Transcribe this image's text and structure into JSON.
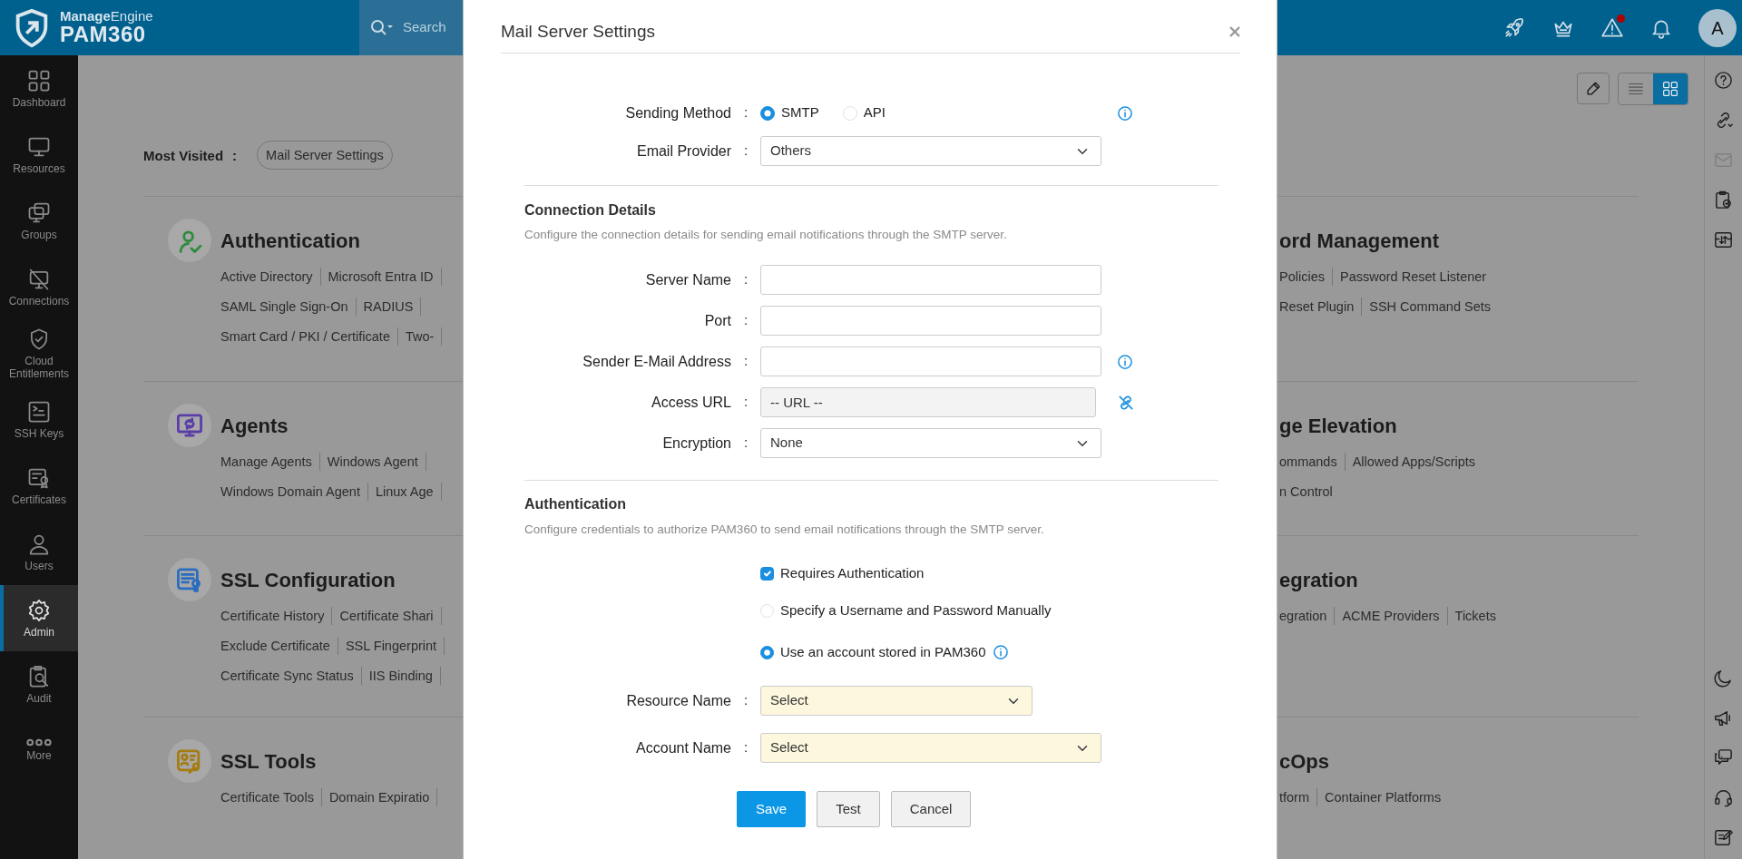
{
  "brand": {
    "company": "**Manage**Engine",
    "product": "PAM360"
  },
  "search": {
    "placeholder": "Search"
  },
  "topbar": {
    "alert_dot": true,
    "avatar": "A"
  },
  "sidebar": {
    "items": [
      {
        "label": "Dashboard",
        "selected": false
      },
      {
        "label": "Resources",
        "selected": false
      },
      {
        "label": "Groups",
        "selected": false
      },
      {
        "label": "Connections",
        "selected": false
      },
      {
        "label": "Cloud Entitlements",
        "selected": false
      },
      {
        "label": "SSH Keys",
        "selected": false
      },
      {
        "label": "Certificates",
        "selected": false
      },
      {
        "label": "Users",
        "selected": false
      },
      {
        "label": "Admin",
        "selected": true
      },
      {
        "label": "Audit",
        "selected": false
      },
      {
        "label": "More",
        "selected": false
      }
    ]
  },
  "toolbar": {
    "views": [
      {
        "kind": "list",
        "selected": false
      },
      {
        "kind": "grid",
        "selected": true
      }
    ]
  },
  "most_visited": {
    "label": "Most Visited",
    "colon": ":",
    "chips": [
      "Mail Server Settings"
    ]
  },
  "sections_left": [
    {
      "title": "Authentication",
      "color": "#2e8b3e",
      "rows": [
        [
          "Active Directory",
          "Microsoft Entra ID"
        ],
        [
          "SAML Single Sign-On",
          "RADIUS"
        ],
        [
          "Smart Card / PKI / Certificate",
          "Two-"
        ]
      ]
    },
    {
      "title": "Agents",
      "color": "#5a3da8",
      "rows": [
        [
          "Manage Agents",
          "Windows Agent"
        ],
        [
          "Windows Domain Agent",
          "Linux Age"
        ]
      ]
    },
    {
      "title": "SSL Configuration",
      "color": "#2a6cc0",
      "rows": [
        [
          "Certificate History",
          "Certificate Shari"
        ],
        [
          "Exclude Certificate",
          "SSL Fingerprint"
        ],
        [
          "Certificate Sync Status",
          "IIS Binding"
        ]
      ]
    },
    {
      "title": "SSL Tools",
      "color": "#a57c12",
      "rows": [
        [
          "Certificate Tools",
          "Domain Expiratio"
        ]
      ]
    }
  ],
  "sections_right": [
    {
      "title": "ord Management",
      "rows": [
        [
          "Policies",
          "Password Reset Listener"
        ],
        [
          "Reset Plugin",
          "SSH Command Sets"
        ]
      ]
    },
    {
      "title": "ge Elevation",
      "rows": [
        [
          "ommands",
          "Allowed Apps/Scripts"
        ],
        [
          "n Control"
        ]
      ]
    },
    {
      "title": "egration",
      "rows": [
        [
          "egration",
          "ACME Providers",
          "Tickets"
        ]
      ]
    },
    {
      "title": "cOps",
      "rows": [
        [
          "tform",
          "Container Platforms"
        ]
      ]
    }
  ],
  "rail": {
    "top": [
      {
        "kind": "help",
        "disabled": false
      },
      {
        "kind": "link",
        "disabled": false
      },
      {
        "kind": "mail",
        "disabled": true
      },
      {
        "kind": "clipboard",
        "disabled": false
      },
      {
        "kind": "transfer",
        "disabled": false
      }
    ],
    "bottom": [
      {
        "kind": "moon",
        "disabled": false
      },
      {
        "kind": "megaphone",
        "disabled": false
      },
      {
        "kind": "chat",
        "disabled": false
      },
      {
        "kind": "headset",
        "disabled": false
      },
      {
        "kind": "note",
        "disabled": false
      }
    ]
  },
  "modal": {
    "title": "Mail Server Settings",
    "sending_method": {
      "label": "Sending Method",
      "colon": ":",
      "options": [
        {
          "label": "SMTP",
          "selected": true
        },
        {
          "label": "API",
          "selected": false
        }
      ]
    },
    "email_provider": {
      "label": "Email Provider",
      "colon": ":",
      "value": "Others"
    },
    "connection": {
      "title": "Connection Details",
      "description": "Configure the connection details for sending email notifications through the SMTP server.",
      "fields": [
        {
          "kind": "text",
          "label": "Server Name",
          "colon": ":"
        },
        {
          "kind": "text",
          "label": "Port",
          "colon": ":"
        },
        {
          "kind": "text",
          "label": "Sender E-Mail Address",
          "colon": ":",
          "info": true
        },
        {
          "kind": "url",
          "label": "Access URL",
          "colon": ":",
          "placeholder": "-- URL --"
        },
        {
          "kind": "select",
          "label": "Encryption",
          "colon": ":",
          "value": "None"
        }
      ]
    },
    "authentication": {
      "title": "Authentication",
      "description": "Configure credentials to authorize PAM360 to send email notifications through the SMTP server.",
      "requires": {
        "label": "Requires Authentication",
        "checked": true
      },
      "modes": [
        {
          "label": "Specify a Username and Password Manually",
          "selected": false
        },
        {
          "label": "Use an account stored in PAM360",
          "selected": true,
          "info": true
        }
      ],
      "resource_name": {
        "label": "Resource Name",
        "colon": ":",
        "value": "Select"
      },
      "account_name": {
        "label": "Account Name",
        "colon": ":",
        "value": "Select"
      }
    },
    "buttons": [
      {
        "label": "Save",
        "kind": "primary"
      },
      {
        "label": "Test",
        "kind": "secondary"
      },
      {
        "label": "Cancel",
        "kind": "secondary"
      }
    ]
  }
}
